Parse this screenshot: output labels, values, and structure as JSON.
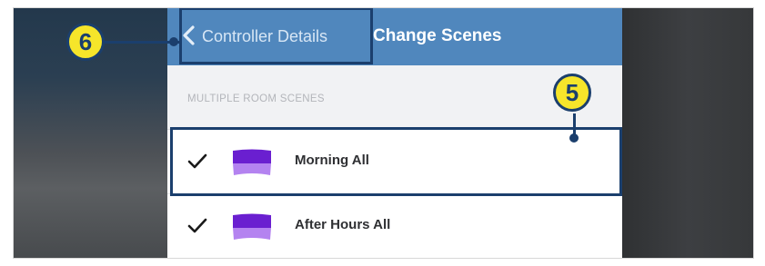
{
  "header": {
    "back_label": "Controller Details",
    "title": "Change Scenes",
    "back_icon": "chevron-left-icon",
    "background_color": "#5087bd"
  },
  "section": {
    "header": "MULTIPLE ROOM SCENES"
  },
  "scenes": [
    {
      "label": "Morning All",
      "selected": true,
      "check_icon": "checkmark-icon",
      "scene_icon": "scene-swatch-icon"
    },
    {
      "label": "After Hours All",
      "selected": true,
      "check_icon": "checkmark-icon",
      "scene_icon": "scene-swatch-icon"
    }
  ],
  "callouts": [
    {
      "number": "6",
      "target": "back-button"
    },
    {
      "number": "5",
      "target": "scene-row-morning-all"
    }
  ],
  "colors": {
    "callout_fill": "#f6e52a",
    "callout_outline": "#1b3f6d",
    "scene_icon_top": "#6a1fd0",
    "scene_icon_bottom": "#b483f0"
  }
}
